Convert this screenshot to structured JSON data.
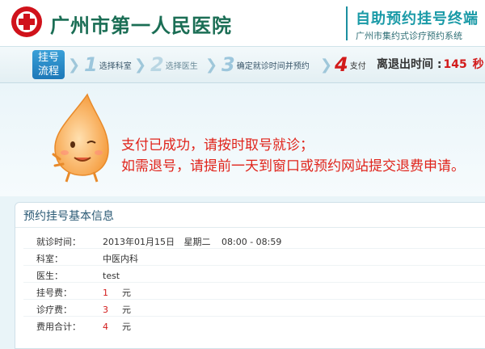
{
  "header": {
    "hospital_name": "广州市第一人民医院",
    "terminal_title": "自助预约挂号终端",
    "terminal_subtitle": "广州市集约式诊疗预约系统"
  },
  "steps": {
    "flow_label_line1": "挂号",
    "flow_label_line2": "流程",
    "items": [
      {
        "num": "1",
        "label": "选择科室",
        "state": "done"
      },
      {
        "num": "2",
        "label": "选择医生",
        "state": "pending"
      },
      {
        "num": "3",
        "label": "确定就诊时间并预约",
        "state": "done"
      },
      {
        "num": "4",
        "label": "支付",
        "state": "active"
      }
    ],
    "countdown_label": "离退出时间 :",
    "countdown_value": "145",
    "countdown_unit": "秒"
  },
  "success": {
    "line1": "支付已成功，请按时取号就诊；",
    "line2": "如需退号，请提前一天到窗口或预约网站提交退费申请。"
  },
  "info": {
    "title": "预约挂号基本信息",
    "visit_time_label": "就诊时间：",
    "visit_date": "2013年01月15日",
    "visit_weekday": "星期二",
    "visit_slot": "08:00 - 08:59",
    "dept_label": "科室：",
    "dept_value": "中医内科",
    "doctor_label": "医生：",
    "doctor_value": "test",
    "reg_fee_label": "挂号费：",
    "reg_fee_value": "1",
    "treat_fee_label": "诊疗费：",
    "treat_fee_value": "3",
    "total_label": "费用合计：",
    "total_value": "4",
    "currency_unit": "元"
  },
  "colors": {
    "brand_green": "#1b6e55",
    "accent_red": "#d21b1b",
    "step_blue": "#1d78b8"
  }
}
